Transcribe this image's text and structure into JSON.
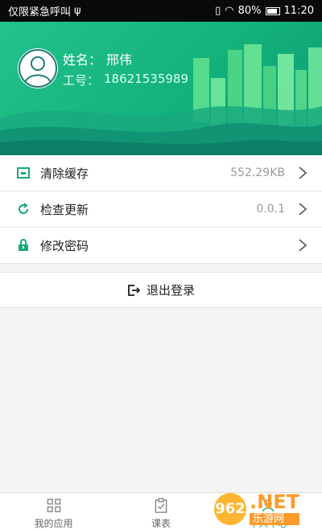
{
  "status_bar": {
    "left_text": "仅限紧急呼叫",
    "usb_glyph": "ψ",
    "battery": "80%",
    "time": "11:20"
  },
  "profile": {
    "name_label": "姓名：",
    "name_value": "邢伟",
    "id_label": "工号：",
    "id_value": "18621535989"
  },
  "menu": {
    "items": [
      {
        "label": "清除缓存",
        "value": "552.29KB",
        "icon": "folder-icon"
      },
      {
        "label": "检查更新",
        "value": "0.0.1",
        "icon": "refresh-icon"
      },
      {
        "label": "修改密码",
        "value": "",
        "icon": "lock-icon"
      }
    ]
  },
  "logout": {
    "label": "退出登录"
  },
  "tabbar": {
    "tabs": [
      {
        "label": "我的应用",
        "icon": "grid-icon"
      },
      {
        "label": "课表",
        "icon": "clipboard-check-icon"
      },
      {
        "label": "个人中心",
        "icon": "user-icon"
      }
    ]
  },
  "watermark": {
    "badge": "962",
    "top": ".NET",
    "bottom": "乐游网"
  },
  "colors": {
    "accent": "#1cb07f",
    "header_start": "#23c28b",
    "menu_icon": "#1aa87a"
  }
}
